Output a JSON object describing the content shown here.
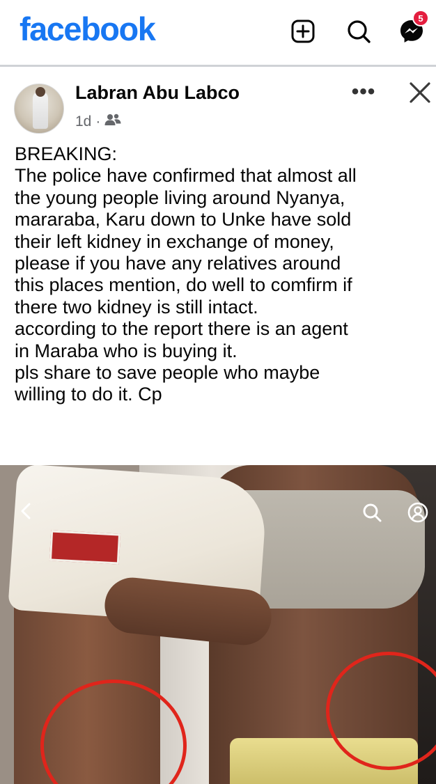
{
  "app": {
    "logo_text": "facebook",
    "brand_color": "#1877f2",
    "notification_count": "5",
    "icons": [
      "plus-square-icon",
      "search-icon",
      "messenger-icon"
    ]
  },
  "post": {
    "author": "Labran Abu Labco",
    "time": "1d",
    "separator": "·",
    "audience_icon": "friends-icon",
    "more_icon": "more-dots-icon",
    "more_label": "•••",
    "close_icon": "close-icon",
    "text_lines": [
      "BREAKING:",
      "The police have confirmed that almost all",
      "the young people living around Nyanya,",
      "mararaba, Karu down to Unke have sold",
      "their left kidney in exchange of money,",
      "please if you have any relatives around",
      "this places mention, do well to comfirm if",
      "there two kidney is still intact.",
      "according to the report there is an agent",
      "in Maraba who is buying it.",
      "pls share to save people who maybe",
      "willing to do it. Cp"
    ]
  },
  "photo": {
    "shirt_print_text": "",
    "overlay_icons": [
      "back-arrow-icon",
      "zoom-icon",
      "face-icon"
    ],
    "highlight_color": "#e0251b"
  }
}
